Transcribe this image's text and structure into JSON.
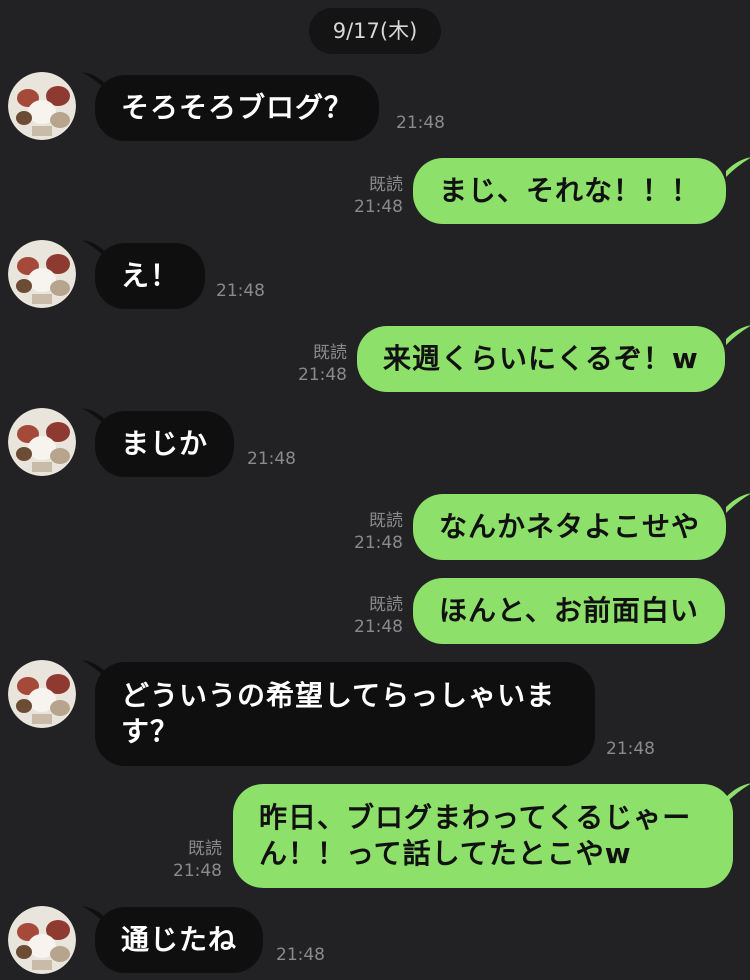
{
  "date_separator": "9/17(木)",
  "colors": {
    "background": "#222224",
    "incoming_bubble": "#0f0f0f",
    "outgoing_bubble": "#8de06a",
    "meta_text": "#8a8a8a"
  },
  "messages": [
    {
      "direction": "incoming",
      "text": "そろそろブログ？",
      "time": "21:48"
    },
    {
      "direction": "outgoing",
      "text": "まじ、それな！！！",
      "read": "既読",
      "time": "21:48"
    },
    {
      "direction": "incoming",
      "text": "え！",
      "time": "21:48"
    },
    {
      "direction": "outgoing",
      "text": "来週くらいにくるぞ！w",
      "read": "既読",
      "time": "21:48"
    },
    {
      "direction": "incoming",
      "text": "まじか",
      "time": "21:48"
    },
    {
      "direction": "outgoing",
      "text": "なんかネタよこせや",
      "read": "既読",
      "time": "21:48"
    },
    {
      "direction": "outgoing",
      "text": "ほんと、お前面白い",
      "read": "既読",
      "time": "21:48"
    },
    {
      "direction": "incoming",
      "text": "どういうの希望してらっしゃいます？",
      "time": "21:48"
    },
    {
      "direction": "outgoing",
      "text": "昨日、ブログまわってくるじゃーん！！って話してたとこやw",
      "read": "既読",
      "time": "21:48"
    },
    {
      "direction": "incoming",
      "text": "通じたね",
      "time": "21:48"
    }
  ]
}
